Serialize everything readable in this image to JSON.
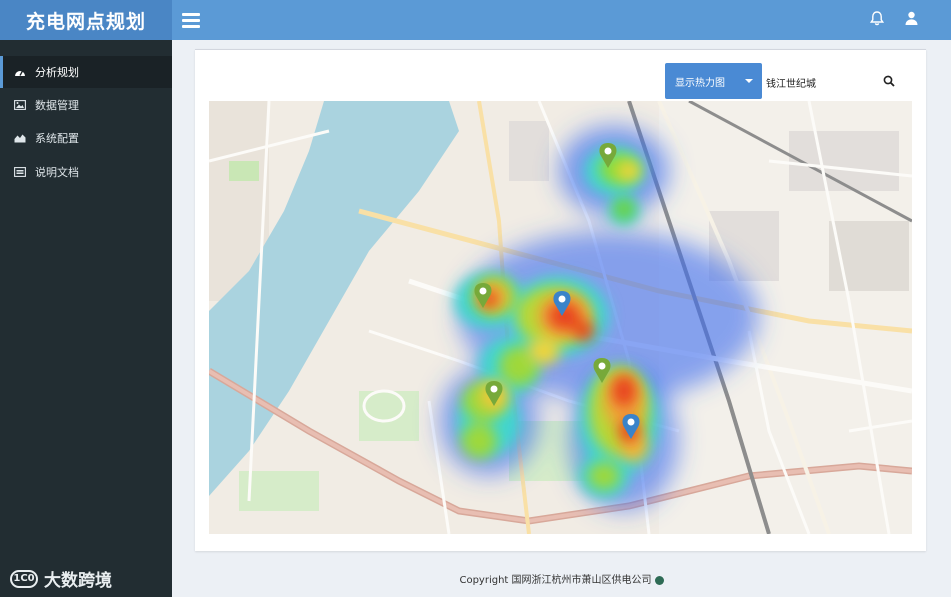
{
  "app": {
    "title": "充电网点规划"
  },
  "header": {
    "menu_icon": "hamburger-icon",
    "notification_icon": "bell-icon",
    "user_icon": "user-icon"
  },
  "sidebar": {
    "items": [
      {
        "label": "分析规划",
        "icon": "dashboard-icon",
        "active": true
      },
      {
        "label": "数据管理",
        "icon": "image-icon",
        "active": false
      },
      {
        "label": "系统配置",
        "icon": "area-chart-icon",
        "active": false
      },
      {
        "label": "说明文档",
        "icon": "list-icon",
        "active": false
      }
    ]
  },
  "toolbar": {
    "heatmap_button_label": "显示热力图",
    "search_value": "钱江世纪城",
    "search_icon": "search-icon"
  },
  "map": {
    "markers": [
      {
        "type": "green",
        "icon": "map-marker-icon"
      },
      {
        "type": "green",
        "icon": "map-marker-icon"
      },
      {
        "type": "blue",
        "icon": "map-marker-icon"
      },
      {
        "type": "green",
        "icon": "map-marker-icon"
      },
      {
        "type": "green",
        "icon": "map-marker-icon"
      },
      {
        "type": "blue",
        "icon": "map-marker-icon"
      }
    ],
    "colors": {
      "water": "#aad3df",
      "land": "#f1ece4",
      "heat_hot": "#e8431f",
      "heat_cool": "#3a6cf0"
    }
  },
  "footer": {
    "copyright": "Copyright 国网浙江杭州市萧山区供电公司"
  },
  "watermark": {
    "text": "大数跨境"
  },
  "colors": {
    "header": "#5b9ad6",
    "brand": "#4a86c5",
    "sidebar": "#222d32",
    "button": "#4a8ad4"
  }
}
